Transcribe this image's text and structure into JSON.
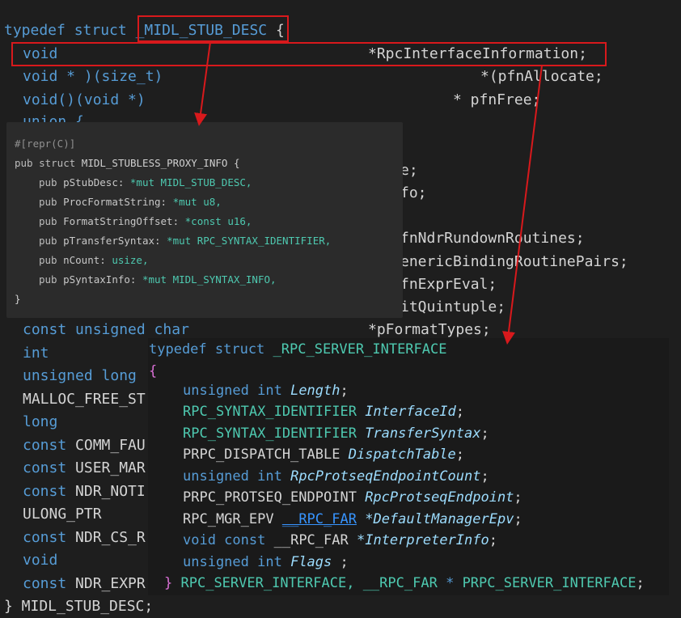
{
  "background_code": {
    "line1": {
      "kw1": "typedef",
      "kw2": "struct",
      "name": "_MIDL_STUB_DESC",
      "brace": "{"
    },
    "line2": {
      "type": "void",
      "field": "*RpcInterfaceInformation;"
    },
    "line3": {
      "type": "void * )(size_t)",
      "field": "*(pfnAllocate;"
    },
    "line4": {
      "type": "void()(void *)",
      "field": "* pfnFree;"
    },
    "line5": {
      "type": "union {"
    },
    "hidden_fragments": {
      "f1": "e;",
      "f2": "fo;",
      "f3": "fnNdrRundownRoutines;",
      "f4": "enericBindingRoutinePairs;",
      "f5": "fnExprEval;",
      "f6": "itQuintuple;"
    },
    "line_format": {
      "type": "const unsigned char",
      "field": "*pFormatTypes;"
    },
    "left_column": [
      {
        "text": "int",
        "cls": "kw"
      },
      {
        "text": "unsigned long",
        "cls": "kw"
      },
      {
        "text": "MALLOC_FREE_ST",
        "cls": "plain"
      },
      {
        "text": "long",
        "cls": "kw"
      },
      {
        "kw": "const",
        "text": "COMM_FAU"
      },
      {
        "kw": "const",
        "text": "USER_MAR"
      },
      {
        "kw": "const",
        "text": "NDR_NOTI"
      },
      {
        "text": "ULONG_PTR",
        "cls": "plain"
      },
      {
        "kw": "const",
        "text": "NDR_CS_R"
      },
      {
        "text": "void",
        "cls": "kw"
      },
      {
        "kw": "const",
        "text": "NDR_EXPR"
      }
    ],
    "closing": "} MIDL_STUB_DESC;"
  },
  "rust_popup": {
    "attr": "#[repr(C)]",
    "header": {
      "kw": "pub struct",
      "name": "MIDL_STUBLESS_PROXY_INFO {"
    },
    "fields": [
      {
        "kw": "pub",
        "name": "pStubDesc:",
        "ptr": "*mut",
        "type": "MIDL_STUB_DESC,"
      },
      {
        "kw": "pub",
        "name": "ProcFormatString:",
        "ptr": "*mut",
        "type": "u8,"
      },
      {
        "kw": "pub",
        "name": "FormatStringOffset:",
        "ptr": "*const",
        "type": "u16,"
      },
      {
        "kw": "pub",
        "name": "pTransferSyntax:",
        "ptr": "*mut",
        "type": "RPC_SYNTAX_IDENTIFIER,"
      },
      {
        "kw": "pub",
        "name": "nCount:",
        "ptr": "",
        "type": "usize,"
      },
      {
        "kw": "pub",
        "name": "pSyntaxInfo:",
        "ptr": "*mut",
        "type": "MIDL_SYNTAX_INFO,"
      }
    ],
    "close": "}"
  },
  "c_popup": {
    "header": {
      "kw": "typedef struct",
      "name": "_RPC_SERVER_INTERFACE"
    },
    "open": "{",
    "fields": [
      {
        "type_kw": "unsigned int",
        "type": "",
        "name": "Length",
        "tail": ";"
      },
      {
        "type_kw": "",
        "type": "RPC_SYNTAX_IDENTIFIER",
        "name": "InterfaceId",
        "tail": ";"
      },
      {
        "type_kw": "",
        "type": "RPC_SYNTAX_IDENTIFIER",
        "name": "TransferSyntax",
        "tail": ";"
      },
      {
        "type_kw": "",
        "type": "PRPC_DISPATCH_TABLE",
        "name": "DispatchTable",
        "tail": ";"
      },
      {
        "type_kw": "unsigned int",
        "type": "",
        "name": "RpcProtseqEndpointCount",
        "tail": ";"
      },
      {
        "type_kw": "",
        "type": "PRPC_PROTSEQ_ENDPOINT",
        "name": "RpcProtseqEndpoint",
        "tail": ";"
      },
      {
        "type_kw": "",
        "type": "RPC_MGR_EPV",
        "far": "__RPC_FAR",
        "name": "*DefaultManagerEpv",
        "tail": ";"
      },
      {
        "type_kw": "void const",
        "type": "",
        "far": "__RPC_FAR",
        "name": "*InterpreterInfo",
        "tail": ";"
      },
      {
        "type_kw": "unsigned int",
        "type": "",
        "name": "Flags",
        "tail": " ;"
      }
    ],
    "closing": {
      "brace": "}",
      "name1": "RPC_SERVER_INTERFACE,",
      "far": "__RPC_FAR",
      "star": "*",
      "name2": "PRPC_SERVER_INTERFACE",
      "tail": ";"
    }
  },
  "annotation_color": "#d8191c"
}
